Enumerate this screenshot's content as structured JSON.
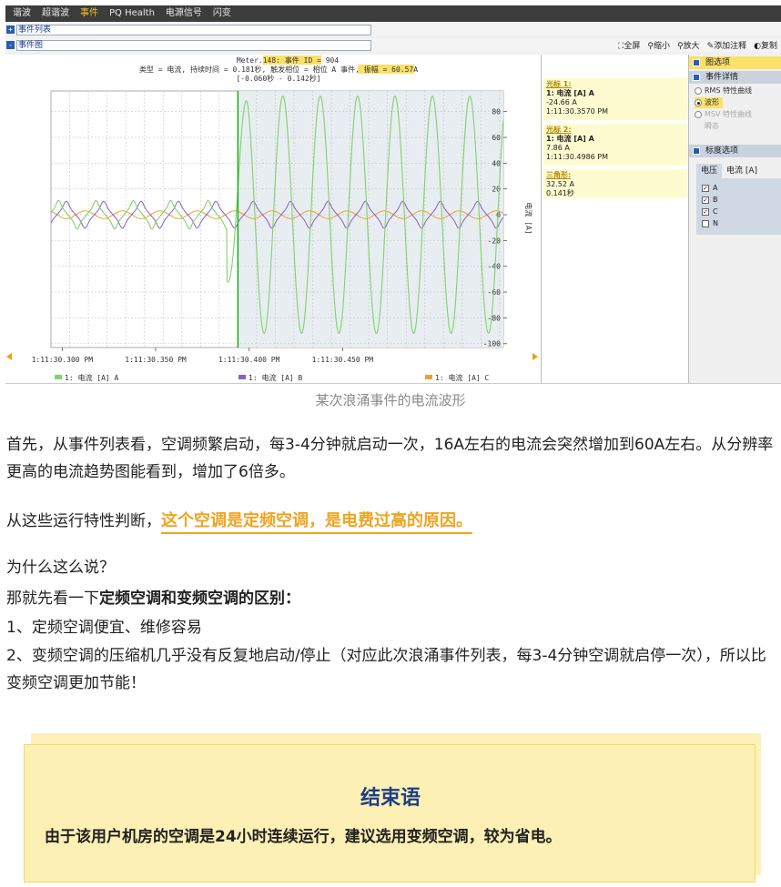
{
  "menubar": {
    "items": [
      "谐波",
      "超谐波",
      "事件",
      "PQ Health",
      "电源信号",
      "闪变"
    ],
    "active_index": 2
  },
  "panels": {
    "event_list": "事件列表",
    "event_chart": "事件图",
    "box_minus": "-",
    "box_plus": "+"
  },
  "toolbar": {
    "fullscreen": "全屏",
    "zoom_out": "缩小",
    "zoom_in": "放大",
    "add_note": "添加注释",
    "copy": "复制"
  },
  "chart": {
    "header_line1_prefix": "Meter.148: ",
    "header_line1_hl": "事件 ID = 904",
    "header_line2_prefix": "类型 = 电流, 持续时间 = 0.181秒, 触发相位 = 相位 A 事件, ",
    "header_line2_hl": "振幅 = 60.57A",
    "header_line3": "[-0.060秒 - 0.142秒]",
    "ylabel": "电流 [A]",
    "legend": [
      "1: 电流 [A] A",
      "1: 电流 [A] B",
      "1: 电流 [A] C"
    ]
  },
  "chart_data": {
    "type": "line",
    "xlabel": "",
    "ylabel": "电流 [A]",
    "ylim": [
      -100,
      100
    ],
    "yticks": [
      80,
      60,
      40,
      20,
      0,
      -20,
      -40,
      -60,
      -80,
      -100
    ],
    "xticks": [
      "1:11:30.300 PM",
      "1:11:30.350 PM",
      "1:11:30.400 PM",
      "1:11:30.450 PM"
    ],
    "xlim_seconds": [
      -0.1,
      0.142
    ],
    "event_start_seconds": 0,
    "series": [
      {
        "name": "1: 电流 [A] A",
        "color": "#7fd36a",
        "pre_event_amplitude": 10,
        "post_event_amplitude": 92,
        "frequency_hz": 50
      },
      {
        "name": "1: 电流 [A] B",
        "color": "#8b5fc0",
        "amplitude": 8,
        "frequency_hz": 50
      },
      {
        "name": "1: 电流 [A] C",
        "color": "#f0a030",
        "amplitude": 3,
        "frequency_hz": 50
      }
    ],
    "grid": true
  },
  "cursors": [
    {
      "title": "光标 1:",
      "series": "1: 电流 [A] A",
      "value": "-24.66 A",
      "time": "1:11:30.3570 PM"
    },
    {
      "title": "光标 2:",
      "series": "1: 电流 [A] A",
      "value": "7.86 A",
      "time": "1:11:30.4986 PM"
    },
    {
      "title": "三角形:",
      "value": "32.52 A",
      "time": "0.141秒"
    }
  ],
  "options": {
    "chart_options": "图选项",
    "event_details": "事件详情",
    "rms_curve": "RMS 特性曲线",
    "waveform": "波形",
    "msv_curve": "MSV 特性曲线",
    "transient": "瞬态",
    "scale_options": "标度选项",
    "tab_voltage": "电压",
    "tab_current": "电流 [A]",
    "phases": [
      "A",
      "B",
      "C",
      "N"
    ],
    "check_mark": "✓"
  },
  "article": {
    "caption": "某次浪涌事件的电流波形",
    "p1": "首先，从事件列表看，空调频繁启动，每3-4分钟就启动一次，16A左右的电流会突然增加到60A左右。从分辨率更高的电流趋势图能看到，增加了6倍多。",
    "p2_prefix": "从这些运行特性判断，",
    "p2_highlight": "这个空调是定频空调，是电费过高的原因。",
    "p3": "为什么这么说？",
    "p4_prefix": "那就先看一下",
    "p4_bold": "定频空调和变频空调的区别：",
    "p5": "1、定频空调便宜、维修容易",
    "p6": "2、变频空调的压缩机几乎没有反复地启动/停止（对应此次浪涌事件列表，每3-4分钟空调就启停一次），所以比变频空调更加节能！",
    "end_title": "结束语",
    "end_text": "由于该用户机房的空调是24小时连续运行，建议选用变频空调，较为省电。"
  }
}
